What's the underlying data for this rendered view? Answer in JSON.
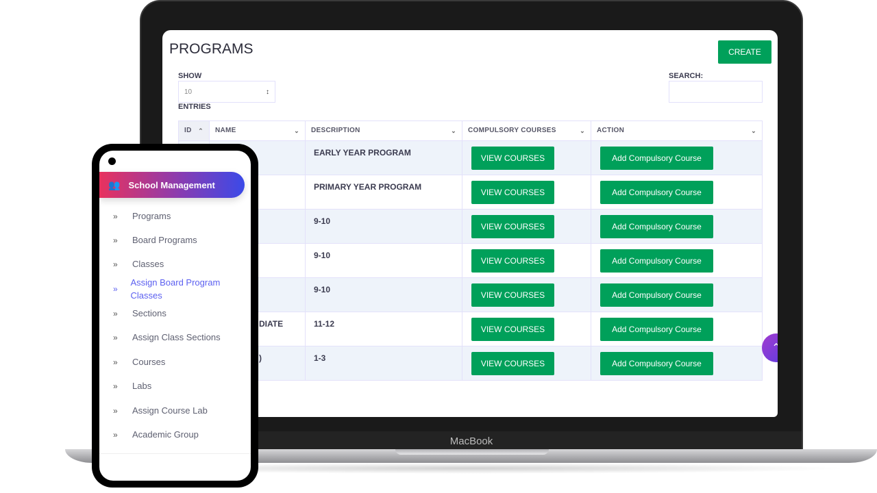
{
  "device": {
    "laptop_label": "MacBook"
  },
  "page": {
    "title": "PROGRAMS",
    "create_label": "CREATE",
    "show_label": "SHOW",
    "entries_label": "ENTRIES",
    "entries_value": "10",
    "search_label": "SEARCH:",
    "search_value": ""
  },
  "table": {
    "headers": [
      "ID",
      "NAME",
      "DESCRIPTION",
      "COMPULSORY COURSES",
      "ACTION"
    ],
    "rows": [
      {
        "name": "",
        "description": "EARLY YEAR PROGRAM",
        "view": "VIEW COURSES",
        "action": "Add Compulsory Course"
      },
      {
        "name": "",
        "description": "PRIMARY YEAR PROGRAM",
        "view": "VIEW COURSES",
        "action": "Add Compulsory Course"
      },
      {
        "name": "",
        "description": "9-10",
        "view": "VIEW COURSES",
        "action": "Add Compulsory Course"
      },
      {
        "name": "",
        "description": "9-10",
        "view": "VIEW COURSES",
        "action": "Add Compulsory Course"
      },
      {
        "name": "",
        "description": "9-10",
        "view": "VIEW COURSES",
        "action": "Add Compulsory Course"
      },
      {
        "name": "DIATE",
        "description": "11-12",
        "view": "VIEW COURSES",
        "action": "Add Compulsory Course"
      },
      {
        "name": ")",
        "description": "1-3",
        "view": "VIEW COURSES",
        "action": "Add Compulsory Course"
      }
    ]
  },
  "phone": {
    "header": "School Management",
    "menu": [
      "Programs",
      "Board Programs",
      "Classes",
      "Assign Board Program Classes",
      "Sections",
      "Assign Class Sections",
      "Courses",
      "Labs",
      "Assign Course Lab",
      "Academic Group"
    ],
    "active_item": "Assign Board Program Classes"
  },
  "colors": {
    "primary_green": "#00a05a",
    "active_link": "#5b5ff0",
    "gradient_start": "#e8325e",
    "gradient_end": "#3b4ae8"
  }
}
